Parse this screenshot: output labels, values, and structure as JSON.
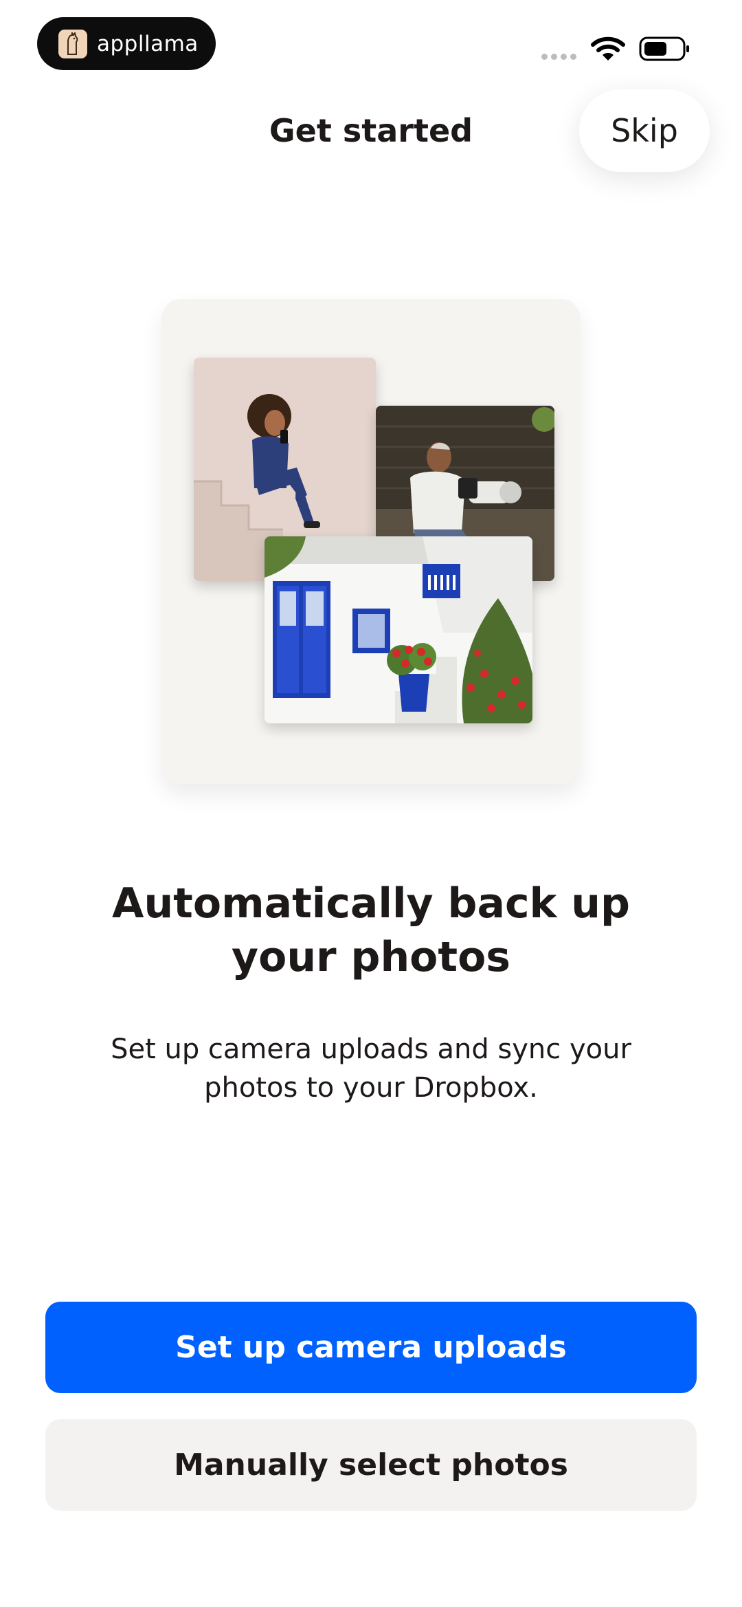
{
  "status_bar": {
    "brand_name": "appllama",
    "icons": [
      "llama-logo-icon",
      "signal-dots-icon",
      "wifi-icon",
      "battery-icon"
    ]
  },
  "nav": {
    "title": "Get started",
    "skip_label": "Skip"
  },
  "illustration": {
    "photos": [
      "selfie-photo",
      "camera-photo",
      "house-photo"
    ]
  },
  "content": {
    "headline_line1": "Automatically back up",
    "headline_line2": "your photos",
    "description_line1": "Set up camera uploads and sync your",
    "description_line2": "photos to your Dropbox."
  },
  "actions": {
    "primary_label": "Set up camera uploads",
    "secondary_label": "Manually select photos"
  },
  "colors": {
    "primary": "#0061fe",
    "secondary_bg": "#f4f2f0",
    "text": "#1e1919"
  }
}
